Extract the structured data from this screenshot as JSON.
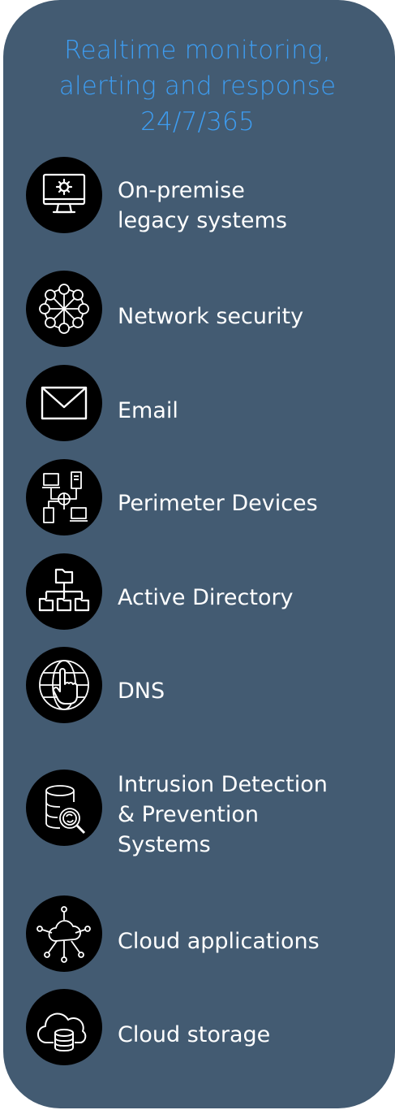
{
  "title": {
    "line1": "Realtime monitoring,",
    "line2": "alerting and response",
    "line3": "24/7/365"
  },
  "items": [
    {
      "icon": "monitor-gear-icon",
      "lines": [
        "On-premise",
        "legacy systems"
      ]
    },
    {
      "icon": "network-nodes-icon",
      "lines": [
        "Network security"
      ]
    },
    {
      "icon": "envelope-icon",
      "lines": [
        "Email"
      ]
    },
    {
      "icon": "connected-devices-icon",
      "lines": [
        "Perimeter Devices"
      ]
    },
    {
      "icon": "hierarchy-icon",
      "lines": [
        "Active Directory"
      ]
    },
    {
      "icon": "globe-pointer-icon",
      "lines": [
        "DNS"
      ]
    },
    {
      "icon": "database-search-icon",
      "lines": [
        "Intrusion Detection",
        "& Prevention",
        "Systems"
      ]
    },
    {
      "icon": "cloud-network-icon",
      "lines": [
        "Cloud applications"
      ]
    },
    {
      "icon": "cloud-database-icon",
      "lines": [
        "Cloud storage"
      ]
    }
  ],
  "colors": {
    "panel": "#435b72",
    "title": "#3d9df2",
    "text": "#ffffff",
    "icon_bg": "#000000"
  }
}
